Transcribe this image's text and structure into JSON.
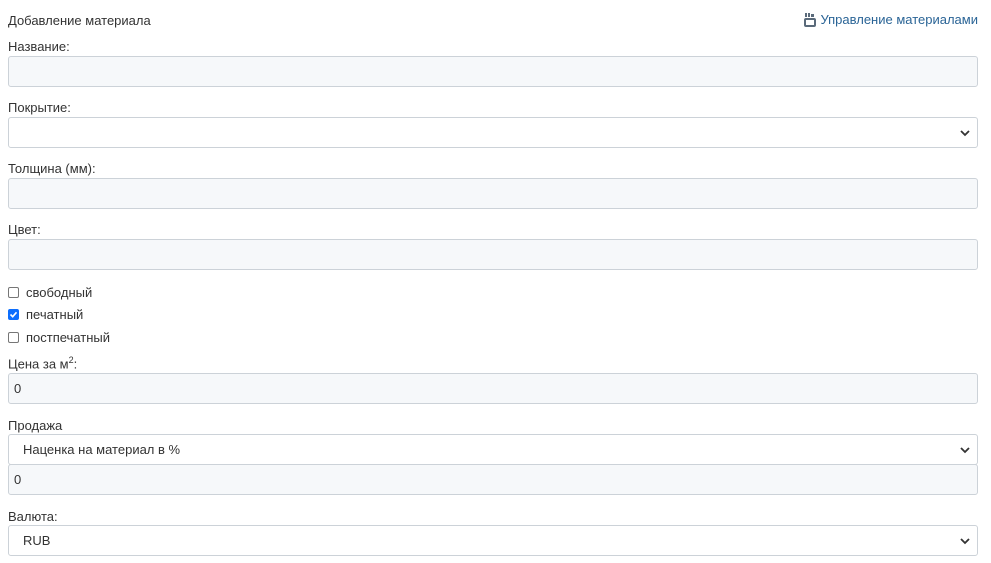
{
  "header": {
    "title": "Добавление материала",
    "manage_link": "Управление материалами",
    "manage_icon": "youtube-icon"
  },
  "fields": {
    "name_label": "Название:",
    "name_value": "",
    "coating_label": "Покрытие:",
    "coating_value": "",
    "thickness_label": "Толщина (мм):",
    "thickness_value": "",
    "color_label": "Цвет:",
    "color_value": ""
  },
  "checkboxes": [
    {
      "label": "свободный",
      "checked": false
    },
    {
      "label": "печатный",
      "checked": true
    },
    {
      "label": "постпечатный",
      "checked": false
    }
  ],
  "price": {
    "label": "Цена за м",
    "label_sup": "2",
    "label_suffix": ":",
    "value": "0"
  },
  "sale": {
    "label": "Продажа",
    "mode_value": "Наценка на материал в %",
    "amount_value": "0"
  },
  "currency": {
    "label": "Валюта:",
    "value": "RUB"
  },
  "colors": {
    "link": "#2a6496",
    "checkbox_checked": "#0d6efd",
    "input_bg": "#f6f8fa"
  }
}
